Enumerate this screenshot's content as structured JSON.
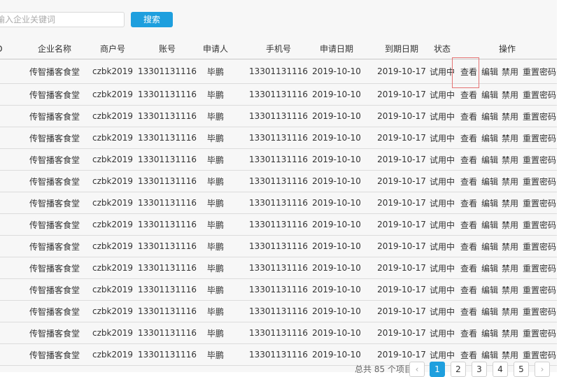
{
  "search": {
    "placeholder": "输入企业关键词",
    "button_label": "搜索"
  },
  "table": {
    "headers": {
      "id": "D",
      "name": "企业名称",
      "merchant": "商户号",
      "account": "账号",
      "applicant": "申请人",
      "phone": "手机号",
      "apply_date": "申请日期",
      "expire_date": "到期日期",
      "status": "状态",
      "actions": "操作"
    },
    "action_labels": {
      "view": "查看",
      "edit": "编辑",
      "ban": "禁用",
      "reset": "重置密码"
    },
    "rows": [
      {
        "name": "传智播客食堂",
        "merchant": "czbk2019",
        "account": "13301131116",
        "applicant": "毕鹏",
        "phone": "13301131116",
        "apply_date": "2019-10-10",
        "expire_date": "2019-10-17",
        "status": "试用中"
      },
      {
        "name": "传智播客食堂",
        "merchant": "czbk2019",
        "account": "13301131116",
        "applicant": "毕鹏",
        "phone": "13301131116",
        "apply_date": "2019-10-10",
        "expire_date": "2019-10-17",
        "status": "试用中"
      },
      {
        "name": "传智播客食堂",
        "merchant": "czbk2019",
        "account": "13301131116",
        "applicant": "毕鹏",
        "phone": "13301131116",
        "apply_date": "2019-10-10",
        "expire_date": "2019-10-17",
        "status": "试用中"
      },
      {
        "name": "传智播客食堂",
        "merchant": "czbk2019",
        "account": "13301131116",
        "applicant": "毕鹏",
        "phone": "13301131116",
        "apply_date": "2019-10-10",
        "expire_date": "2019-10-17",
        "status": "试用中"
      },
      {
        "name": "传智播客食堂",
        "merchant": "czbk2019",
        "account": "13301131116",
        "applicant": "毕鹏",
        "phone": "13301131116",
        "apply_date": "2019-10-10",
        "expire_date": "2019-10-17",
        "status": "试用中"
      },
      {
        "name": "传智播客食堂",
        "merchant": "czbk2019",
        "account": "13301131116",
        "applicant": "毕鹏",
        "phone": "13301131116",
        "apply_date": "2019-10-10",
        "expire_date": "2019-10-17",
        "status": "试用中"
      },
      {
        "name": "传智播客食堂",
        "merchant": "czbk2019",
        "account": "13301131116",
        "applicant": "毕鹏",
        "phone": "13301131116",
        "apply_date": "2019-10-10",
        "expire_date": "2019-10-17",
        "status": "试用中"
      },
      {
        "name": "传智播客食堂",
        "merchant": "czbk2019",
        "account": "13301131116",
        "applicant": "毕鹏",
        "phone": "13301131116",
        "apply_date": "2019-10-10",
        "expire_date": "2019-10-17",
        "status": "试用中"
      },
      {
        "name": "传智播客食堂",
        "merchant": "czbk2019",
        "account": "13301131116",
        "applicant": "毕鹏",
        "phone": "13301131116",
        "apply_date": "2019-10-10",
        "expire_date": "2019-10-17",
        "status": "试用中"
      },
      {
        "name": "传智播客食堂",
        "merchant": "czbk2019",
        "account": "13301131116",
        "applicant": "毕鹏",
        "phone": "13301131116",
        "apply_date": "2019-10-10",
        "expire_date": "2019-10-17",
        "status": "试用中"
      },
      {
        "name": "传智播客食堂",
        "merchant": "czbk2019",
        "account": "13301131116",
        "applicant": "毕鹏",
        "phone": "13301131116",
        "apply_date": "2019-10-10",
        "expire_date": "2019-10-17",
        "status": "试用中"
      },
      {
        "name": "传智播客食堂",
        "merchant": "czbk2019",
        "account": "13301131116",
        "applicant": "毕鹏",
        "phone": "13301131116",
        "apply_date": "2019-10-10",
        "expire_date": "2019-10-17",
        "status": "试用中"
      },
      {
        "name": "传智播客食堂",
        "merchant": "czbk2019",
        "account": "13301131116",
        "applicant": "毕鹏",
        "phone": "13301131116",
        "apply_date": "2019-10-10",
        "expire_date": "2019-10-17",
        "status": "试用中"
      },
      {
        "name": "传智播客食堂",
        "merchant": "czbk2019",
        "account": "13301131116",
        "applicant": "毕鹏",
        "phone": "13301131116",
        "apply_date": "2019-10-10",
        "expire_date": "2019-10-17",
        "status": "试用中"
      }
    ]
  },
  "pagination": {
    "total_text": "总共 85 个项目",
    "prev_icon": "‹",
    "next_icon": "›",
    "pages": [
      "1",
      "2",
      "3",
      "4",
      "5"
    ],
    "current": "1"
  },
  "colors": {
    "accent": "#1e9fde",
    "highlight": "#e57373"
  }
}
